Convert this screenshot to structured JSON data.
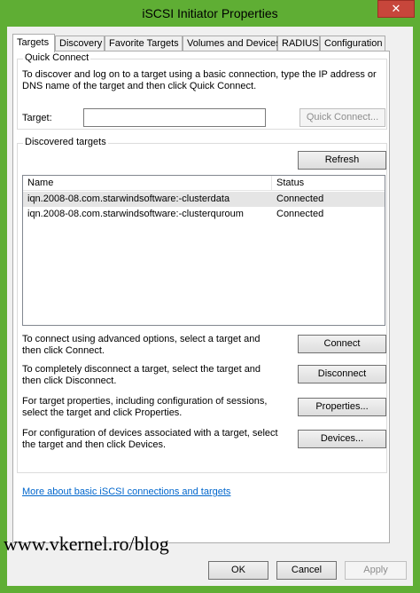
{
  "window": {
    "title": "iSCSI Initiator Properties",
    "close_glyph": "✕"
  },
  "tabs": [
    {
      "label": "Targets",
      "active": true
    },
    {
      "label": "Discovery",
      "active": false
    },
    {
      "label": "Favorite Targets",
      "active": false
    },
    {
      "label": "Volumes and Devices",
      "active": false
    },
    {
      "label": "RADIUS",
      "active": false
    },
    {
      "label": "Configuration",
      "active": false
    }
  ],
  "quick_connect": {
    "group_label": "Quick Connect",
    "description": "To discover and log on to a target using a basic connection, type the IP address or DNS name of the target and then click Quick Connect.",
    "target_label": "Target:",
    "target_value": "",
    "button_label": "Quick Connect..."
  },
  "discovered": {
    "group_label": "Discovered targets",
    "refresh_label": "Refresh",
    "columns": [
      "Name",
      "Status"
    ],
    "rows": [
      {
        "name": "iqn.2008-08.com.starwindsoftware:-clusterdata",
        "status": "Connected",
        "selected": true
      },
      {
        "name": "iqn.2008-08.com.starwindsoftware:-clusterquroum",
        "status": "Connected",
        "selected": false
      }
    ],
    "actions": [
      {
        "text": "To connect using advanced options, select a target and then click Connect.",
        "button": "Connect"
      },
      {
        "text": "To completely disconnect a target, select the target and then click Disconnect.",
        "button": "Disconnect"
      },
      {
        "text": "For target properties, including configuration of sessions, select the target and click Properties.",
        "button": "Properties..."
      },
      {
        "text": "For configuration of devices associated with a target, select the target and then click Devices.",
        "button": "Devices..."
      }
    ]
  },
  "help_link": "More about basic iSCSI connections and targets",
  "footer": {
    "ok": "OK",
    "cancel": "Cancel",
    "apply": "Apply"
  },
  "watermark": "www.vkernel.ro/blog",
  "colors": {
    "chrome": "#5fae34",
    "close": "#c7463b",
    "link": "#0066cc"
  }
}
